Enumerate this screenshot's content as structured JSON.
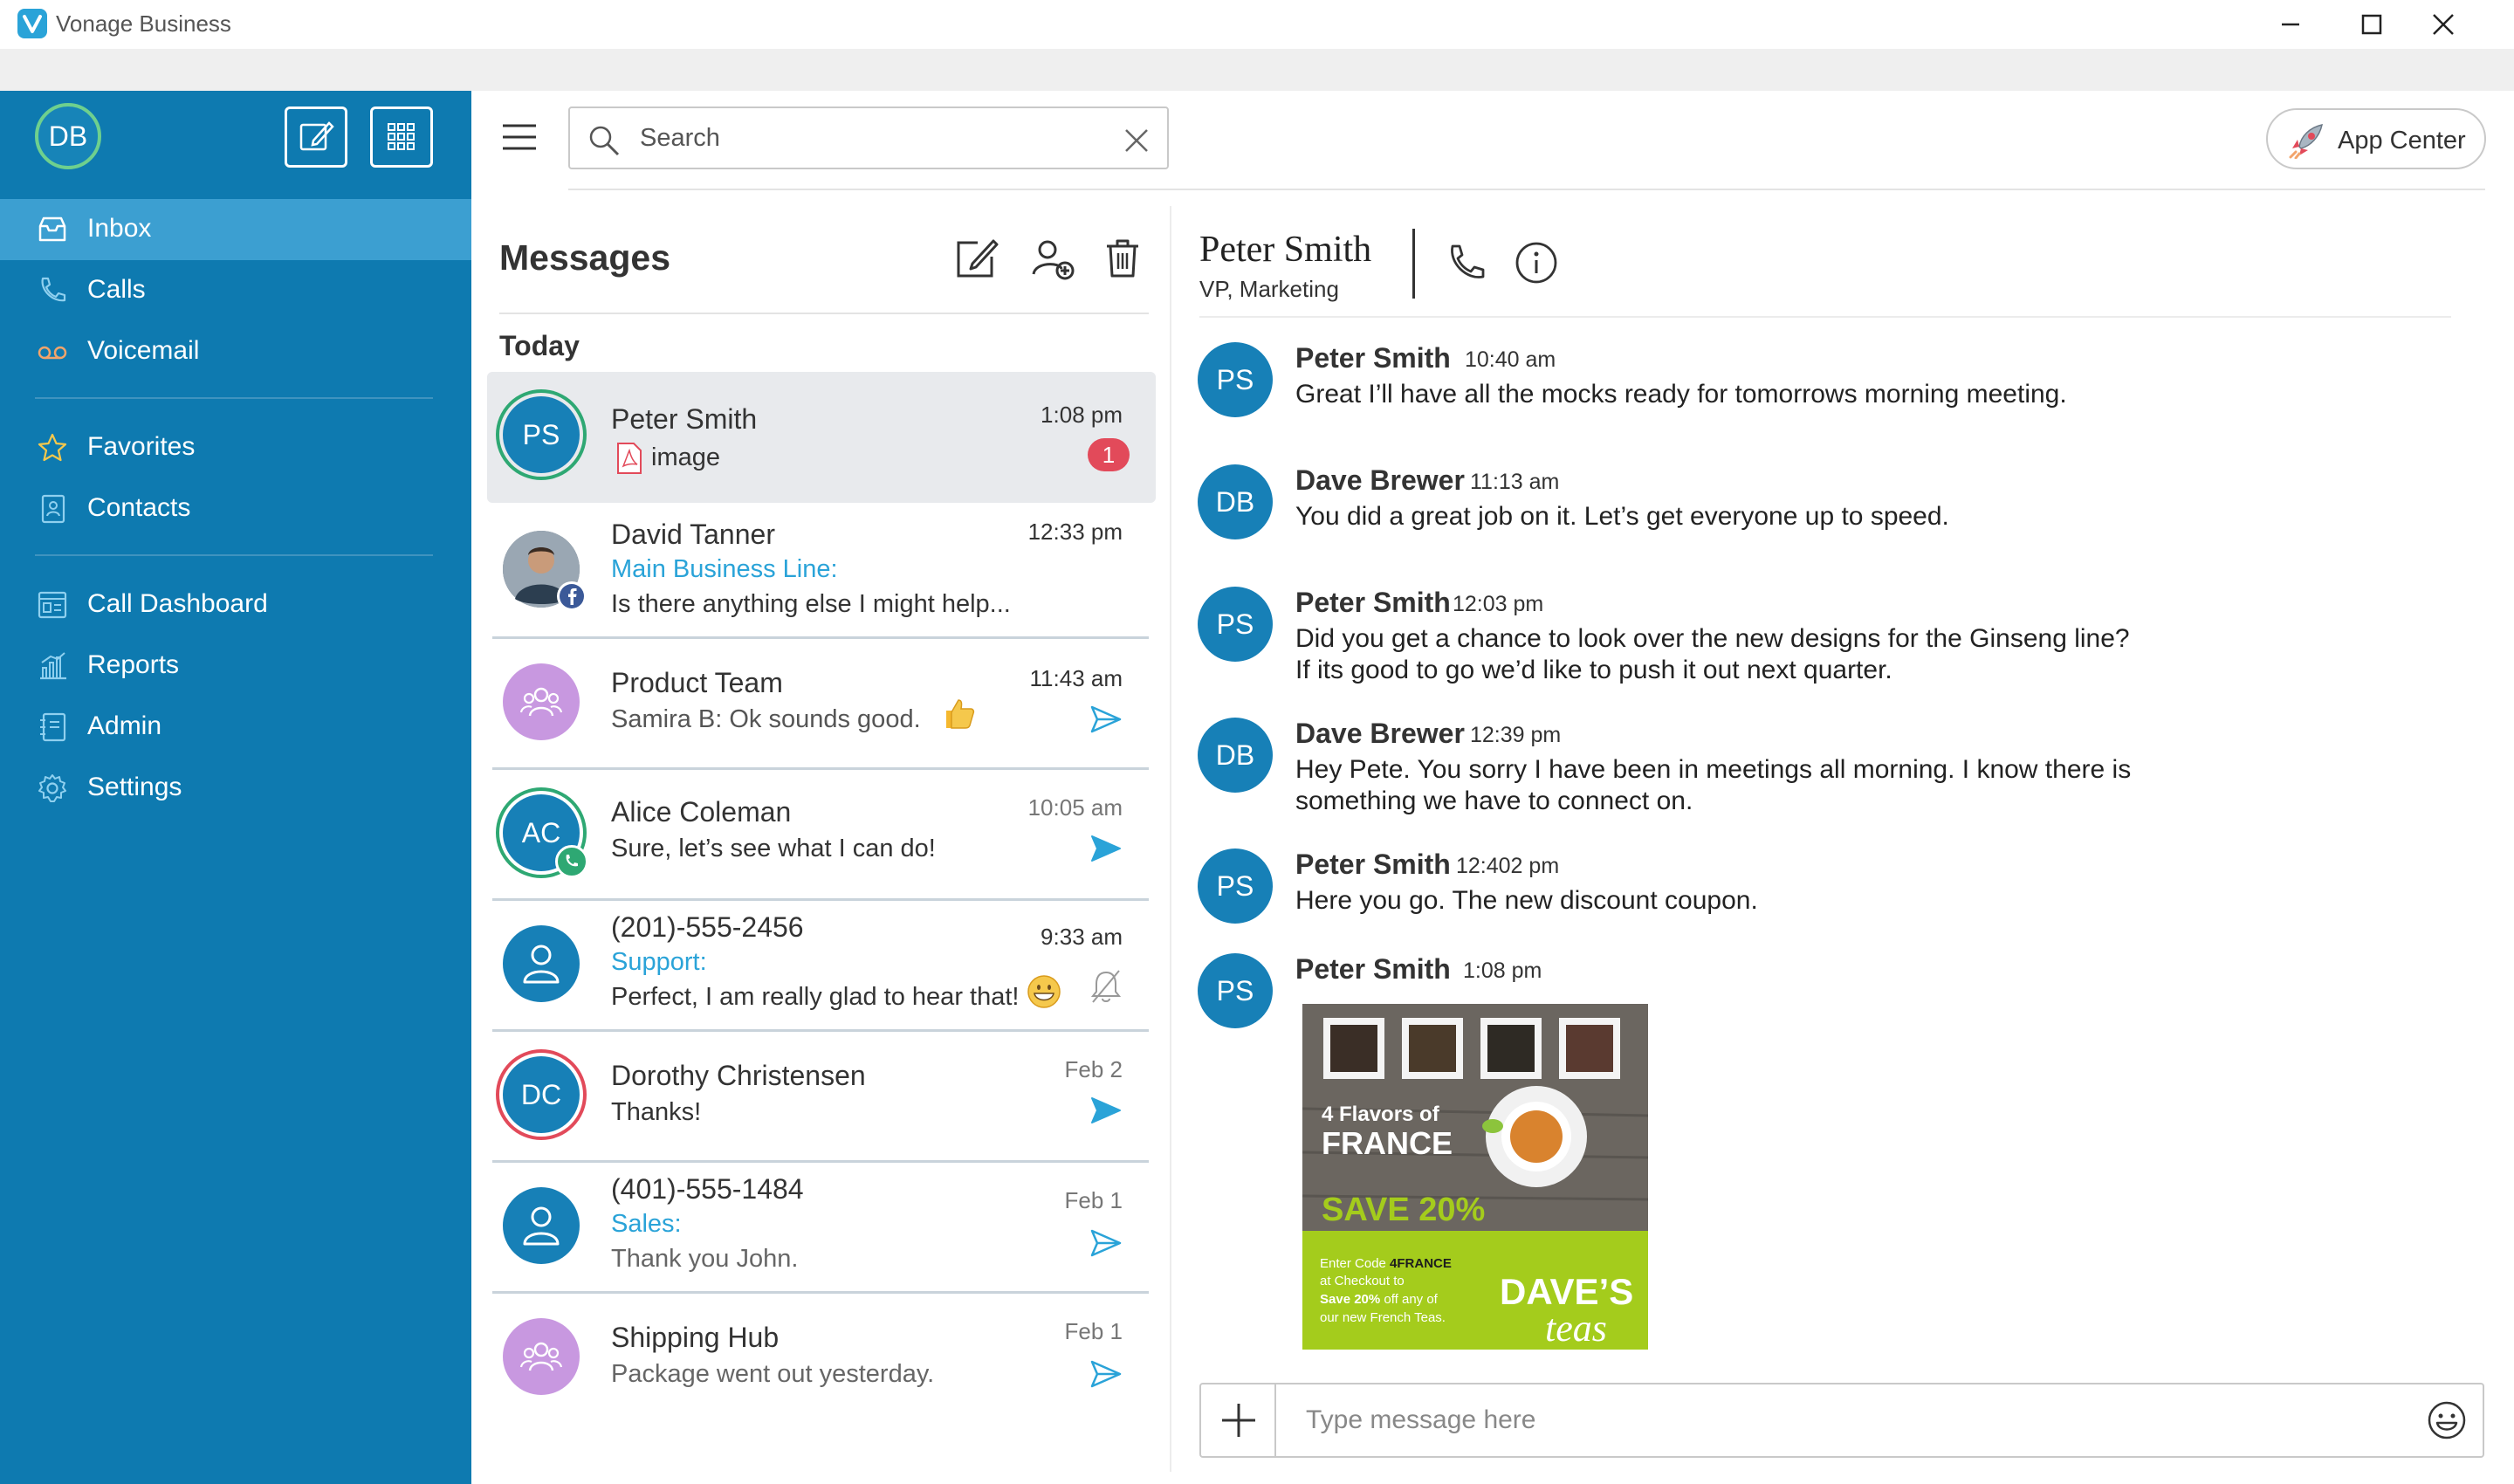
{
  "window": {
    "title": "Vonage Business"
  },
  "user": {
    "initials": "DB"
  },
  "sidebar": {
    "items": [
      {
        "label": "Inbox",
        "icon": "inbox-icon",
        "active": true
      },
      {
        "label": "Calls",
        "icon": "phone-icon"
      },
      {
        "label": "Voicemail",
        "icon": "voicemail-icon"
      },
      {
        "label": "Favorites",
        "icon": "star-icon"
      },
      {
        "label": "Contacts",
        "icon": "contacts-icon"
      },
      {
        "label": "Call Dashboard",
        "icon": "dashboard-icon"
      },
      {
        "label": "Reports",
        "icon": "reports-icon"
      },
      {
        "label": "Admin",
        "icon": "admin-icon"
      },
      {
        "label": "Settings",
        "icon": "gear-icon"
      }
    ]
  },
  "toolbar": {
    "search_placeholder": "Search",
    "app_center": "App Center"
  },
  "messages": {
    "title": "Messages",
    "section": "Today",
    "conversations": [
      {
        "initials": "PS",
        "name": "Peter Smith",
        "preview": "image",
        "time": "1:08 pm",
        "unread": "1"
      },
      {
        "initials": "",
        "name": "David Tanner",
        "line": "Main Business Line:",
        "preview": "Is there anything else I might help...",
        "time": "12:33 pm"
      },
      {
        "initials": "",
        "name": "Product Team",
        "preview": "Samira B: Ok sounds good.",
        "time": "11:43 am"
      },
      {
        "initials": "AC",
        "name": "Alice Coleman",
        "preview": "Sure, let’s see what I can do!",
        "time": "10:05 am"
      },
      {
        "initials": "",
        "name": "(201)-555-2456",
        "line": "Support:",
        "preview": "Perfect, I am really glad to hear that!",
        "time": "9:33 am"
      },
      {
        "initials": "DC",
        "name": "Dorothy Christensen",
        "preview": "Thanks!",
        "time": "Feb 2"
      },
      {
        "initials": "",
        "name": "(401)-555-1484",
        "line": "Sales:",
        "preview": "Thank you John.",
        "time": "Feb 1"
      },
      {
        "initials": "",
        "name": "Shipping Hub",
        "preview": "Package went out yesterday.",
        "time": "Feb 1"
      }
    ]
  },
  "chat": {
    "contact_name": "Peter Smith",
    "contact_role": "VP, Marketing",
    "messages": [
      {
        "initials": "PS",
        "author": "Peter Smith",
        "time": "10:40 am",
        "lines": [
          "Great I’ll have all the mocks ready for tomorrows morning meeting."
        ]
      },
      {
        "initials": "DB",
        "author": "Dave Brewer",
        "time": "11:13 am",
        "lines": [
          "You did a great job on it. Let’s get everyone up to speed."
        ]
      },
      {
        "initials": "PS",
        "author": "Peter Smith",
        "time": "12:03 pm",
        "lines": [
          "Did you get a chance to look over the new designs for the Ginseng line?",
          "If its good to go we’d like to push it out next quarter."
        ]
      },
      {
        "initials": "DB",
        "author": "Dave Brewer",
        "time": "12:39 pm",
        "lines": [
          "Hey Pete.  You sorry I have been in meetings all morning.  I know there is",
          "something we have to connect on."
        ]
      },
      {
        "initials": "PS",
        "author": "Peter Smith",
        "time": "12:402 pm",
        "lines": [
          "Here you go.  The new discount coupon."
        ]
      },
      {
        "initials": "PS",
        "author": "Peter Smith",
        "time": "1:08 pm",
        "lines": []
      }
    ],
    "coupon": {
      "line1": "4 Flavors of",
      "line2": "FRANCE",
      "line3": "SAVE 20%",
      "code_pre": "Enter Code ",
      "code": "4FRANCE",
      "l2": "at Checkout to",
      "l3_bold": "Save 20%",
      "l3_rest": " off any of",
      "l4": "our new French Teas.",
      "brand1": "DAVE’S",
      "brand2": "teas"
    },
    "composer_placeholder": "Type message here"
  },
  "colors": {
    "sidebar": "#0e7ab0",
    "sidebar_active": "#3c9fd1",
    "accent": "#2aa3d8",
    "avatar_blue": "#1780b7",
    "group_purple": "#c898e0",
    "badge_red": "#e24a5a",
    "ring_green": "#2ea873",
    "ring_red": "#e24a5a"
  }
}
